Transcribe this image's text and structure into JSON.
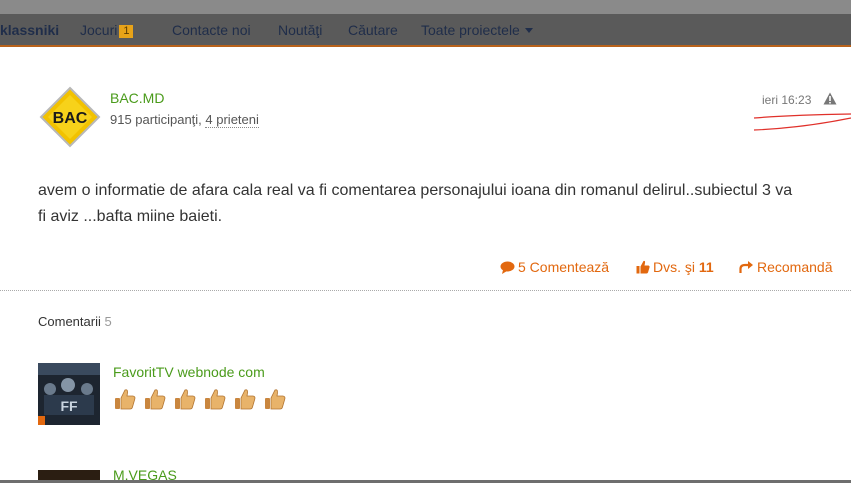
{
  "nav": {
    "logo": "klassniki",
    "items": [
      "Jocuri",
      "Contacte noi",
      "Noutăţi",
      "Căutare",
      "Toate proiectele"
    ],
    "games_badge": "1"
  },
  "post": {
    "logo_text": "BAC",
    "author": "BAC.MD",
    "members": "915 participanţi,",
    "friends": "4 prieteni",
    "time": "ieri 16:23",
    "text": "avem o informatie de afara cala real va fi comentarea personajului ioana din romanul delirul..subiectul 3 va fi aviz ...bafta miine baieti.",
    "comment_action": "5 Comentează",
    "like_action": "Dvs. şi",
    "like_count": "11",
    "recommend_action": "Recomandă"
  },
  "comments": {
    "title": "Comentarii",
    "count": "5",
    "items": [
      {
        "author": "FavoritTV webnode com",
        "thumbs_count": 6
      },
      {
        "author": "M.VEGAS"
      }
    ]
  },
  "colors": {
    "accent": "#e2680f",
    "author_green": "#4a9b1b",
    "logo_yellow": "#f2c200"
  },
  "icons": [
    "warning-icon",
    "comment-icon",
    "thumbs-up-icon",
    "recommend-icon"
  ]
}
